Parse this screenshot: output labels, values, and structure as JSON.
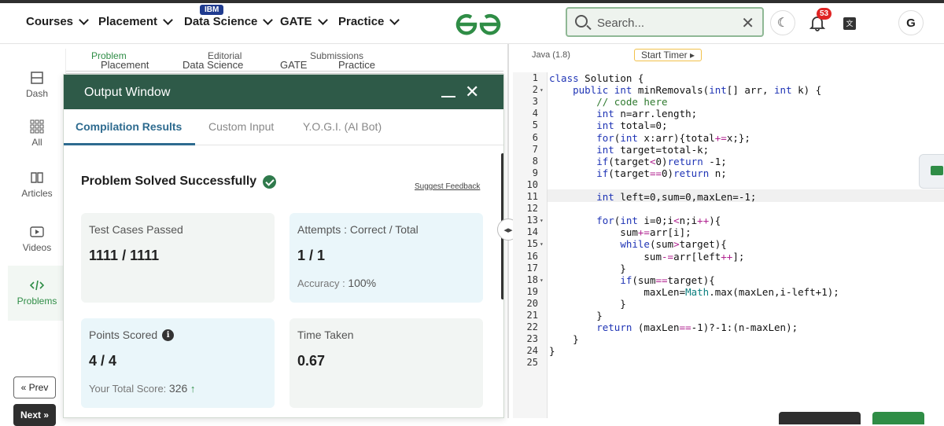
{
  "navbar": {
    "items": [
      "Courses",
      "Placement",
      "Data Science",
      "GATE",
      "Practice"
    ],
    "ibm_badge": "IBM",
    "search_placeholder": "Search...",
    "notification_count": "53",
    "avatar_letter": "G"
  },
  "problem_tabs": [
    "Problem",
    "Editorial",
    "Submissions"
  ],
  "sidebar": {
    "items": [
      "Dash",
      "All",
      "Articles",
      "Videos",
      "Problems"
    ],
    "prev": "Prev",
    "next": "Next"
  },
  "output_window": {
    "title": "Output Window",
    "tabs": [
      "Compilation Results",
      "Custom Input",
      "Y.O.G.I. (AI Bot)"
    ],
    "status": "Problem Solved Successfully",
    "suggest_feedback": "Suggest Feedback",
    "cards": {
      "test_cases": {
        "label": "Test Cases Passed",
        "value": "1111 / 1111"
      },
      "attempts": {
        "label": "Attempts : Correct / Total",
        "value": "1 / 1",
        "accuracy_label": "Accuracy :",
        "accuracy": "100%"
      },
      "points": {
        "label": "Points Scored",
        "value": "4 / 4",
        "total_label": "Your Total Score:",
        "total": "326"
      },
      "time": {
        "label": "Time Taken",
        "value": "0.67"
      }
    }
  },
  "editor": {
    "language": "Java (1.8)",
    "timer": "Start Timer",
    "lines": [
      {
        "n": "1",
        "code": "class Solution {"
      },
      {
        "n": "2",
        "code": "    public int minRemovals(int[] arr, int k) {"
      },
      {
        "n": "3",
        "code": "        // code here"
      },
      {
        "n": "4",
        "code": "        int n=arr.length;"
      },
      {
        "n": "5",
        "code": "        int total=0;"
      },
      {
        "n": "6",
        "code": "        for(int x:arr){total+=x;};"
      },
      {
        "n": "7",
        "code": "        int target=total-k;"
      },
      {
        "n": "8",
        "code": "        if(target<0)return -1;"
      },
      {
        "n": "9",
        "code": "        if(target==0)return n;"
      },
      {
        "n": "10",
        "code": ""
      },
      {
        "n": "11",
        "code": "        int left=0,sum=0,maxLen=-1;"
      },
      {
        "n": "12",
        "code": ""
      },
      {
        "n": "13",
        "code": "        for(int i=0;i<n;i++){"
      },
      {
        "n": "14",
        "code": "            sum+=arr[i];"
      },
      {
        "n": "15",
        "code": "            while(sum>target){"
      },
      {
        "n": "16",
        "code": "                sum-=arr[left++];"
      },
      {
        "n": "17",
        "code": "            }"
      },
      {
        "n": "18",
        "code": "            if(sum==target){"
      },
      {
        "n": "19",
        "code": "                maxLen=Math.max(maxLen,i-left+1);"
      },
      {
        "n": "20",
        "code": "            }"
      },
      {
        "n": "21",
        "code": "        }"
      },
      {
        "n": "22",
        "code": "        return (maxLen==-1)?-1:(n-maxLen);"
      },
      {
        "n": "23",
        "code": "    }"
      },
      {
        "n": "24",
        "code": "}"
      },
      {
        "n": "25",
        "code": ""
      }
    ]
  },
  "colors": {
    "brand_green": "#2f8d46",
    "header_dark_green": "#2e5a48",
    "tab_blue": "#2e6b8f"
  }
}
